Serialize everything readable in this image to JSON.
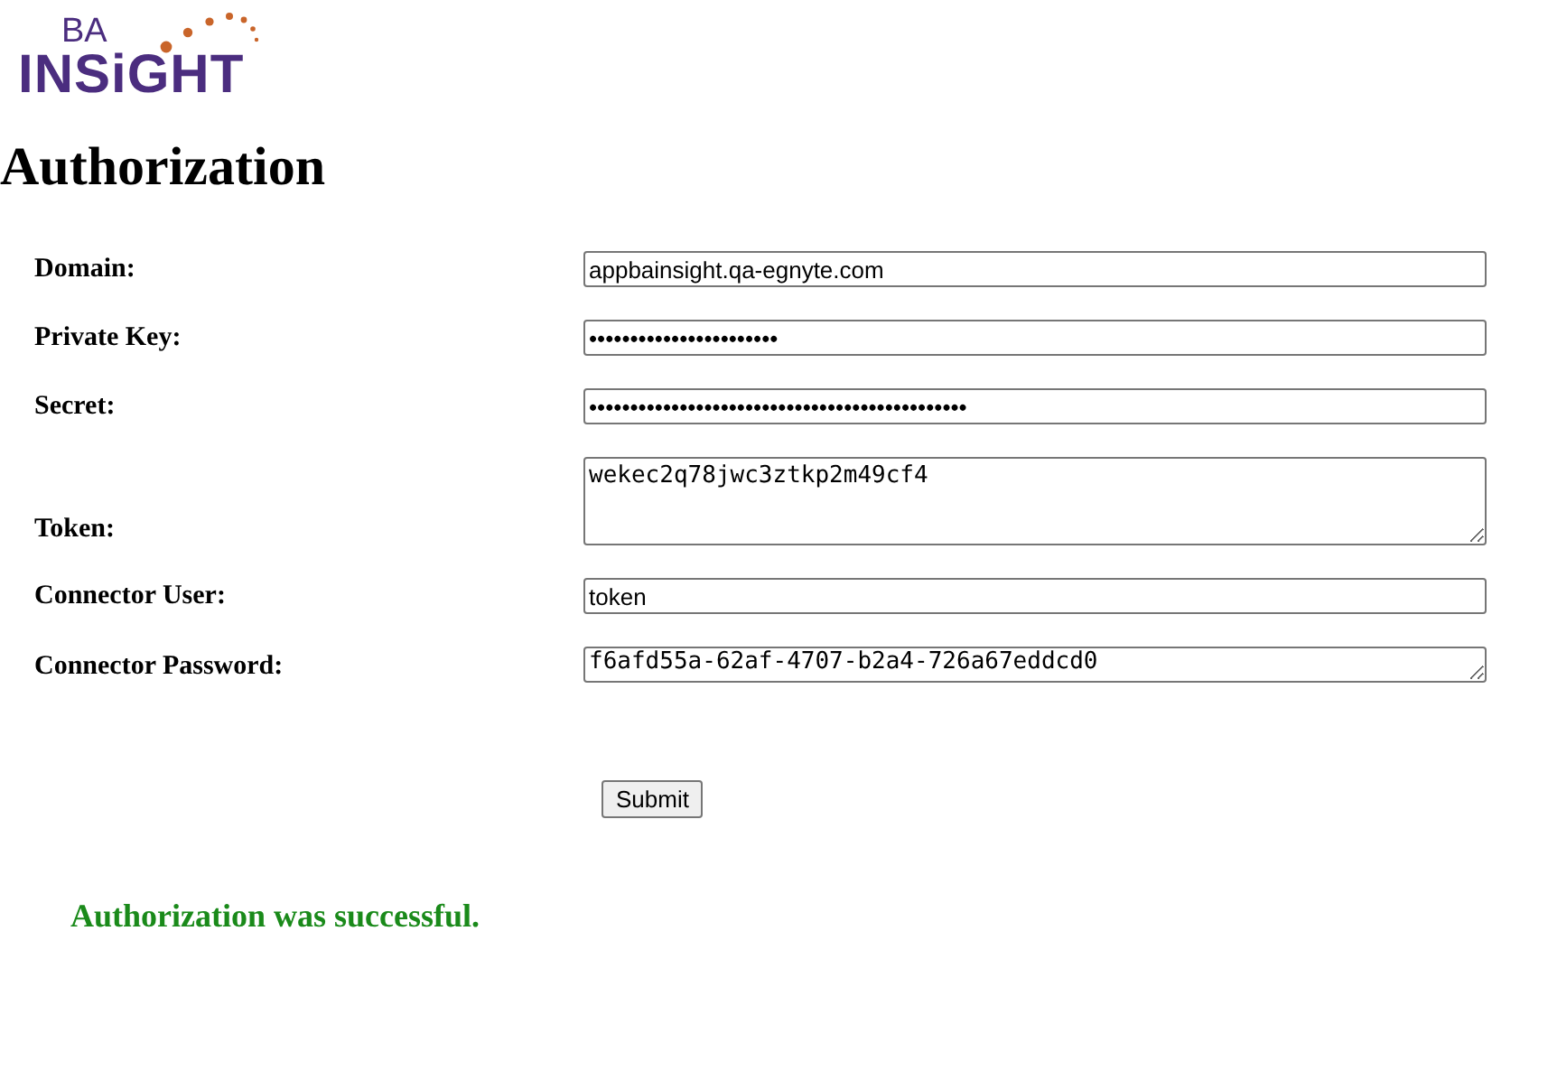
{
  "logo": {
    "small": "BA",
    "large": "INSiGHT"
  },
  "title": "Authorization",
  "fields": [
    {
      "label": "Domain:",
      "kind": "input",
      "value": "appbainsight.qa-egnyte.com"
    },
    {
      "label": "Private Key:",
      "kind": "password",
      "value": "•••••••••••••••••••••••"
    },
    {
      "label": "Secret:",
      "kind": "password",
      "value": "••••••••••••••••••••••••••••••••••••••••••••••"
    },
    {
      "label": "Token:",
      "kind": "textarea",
      "value": "wekec2q78jwc3ztkp2m49cf4"
    },
    {
      "label": "Connector User:",
      "kind": "input",
      "value": "token"
    },
    {
      "label": "Connector Password:",
      "kind": "textarea_small",
      "value": "f6afd55a-62af-4707-b2a4-726a67eddcd0"
    }
  ],
  "submit": "Submit",
  "message": "Authorization was successful."
}
